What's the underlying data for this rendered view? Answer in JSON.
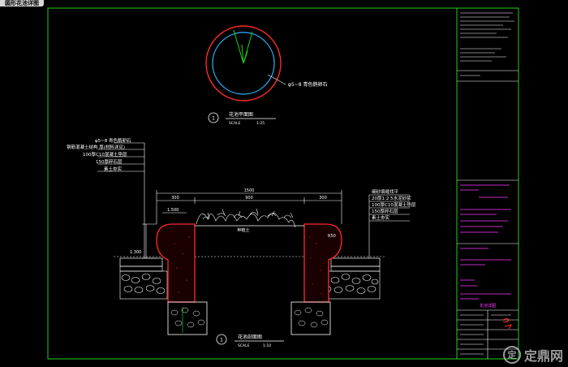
{
  "window": {
    "title": "圆形花池详图"
  },
  "plan": {
    "note": "φ5~8 青色鹅卵石",
    "title": "花池平面图",
    "scale_label": "SCALE",
    "scale": "1:25",
    "num": "1"
  },
  "section": {
    "title": "花池剖面图",
    "scale_label": "SCALE",
    "scale": "1:10",
    "num": "1",
    "dim_total": "1500",
    "dim_left": "300",
    "dim_mid": "900",
    "dim_right": "300",
    "dim_h1": "1.500",
    "dim_h2": "1.300",
    "r_label": "R50",
    "soil_label": "种植土",
    "left_notes": [
      "φ5~8 青色鹅卵石",
      "钢筋混凝土结构 厚(材料详见)",
      "100厚C10混凝土垫层",
      "150厚碎石层",
      "素土夯实"
    ],
    "right_notes": [
      "细砂填缝找平",
      "20厚1:2.5水泥砂浆",
      "100厚C10混凝土垫层",
      "150厚碎石层",
      "素土夯实"
    ]
  },
  "titleblock": {
    "project": "某某园林景观工程",
    "drawing": "圆形花池详图",
    "sheet": "花池详图"
  },
  "watermark": {
    "icon": "zhulong-logo-icon",
    "text": "定鼎网"
  },
  "colors": {
    "line_white": "#ffffff",
    "line_green": "#1fd11f",
    "line_red": "#ff2a2a",
    "line_magenta": "#ff3cff",
    "line_cyan": "#2fb3ff"
  }
}
